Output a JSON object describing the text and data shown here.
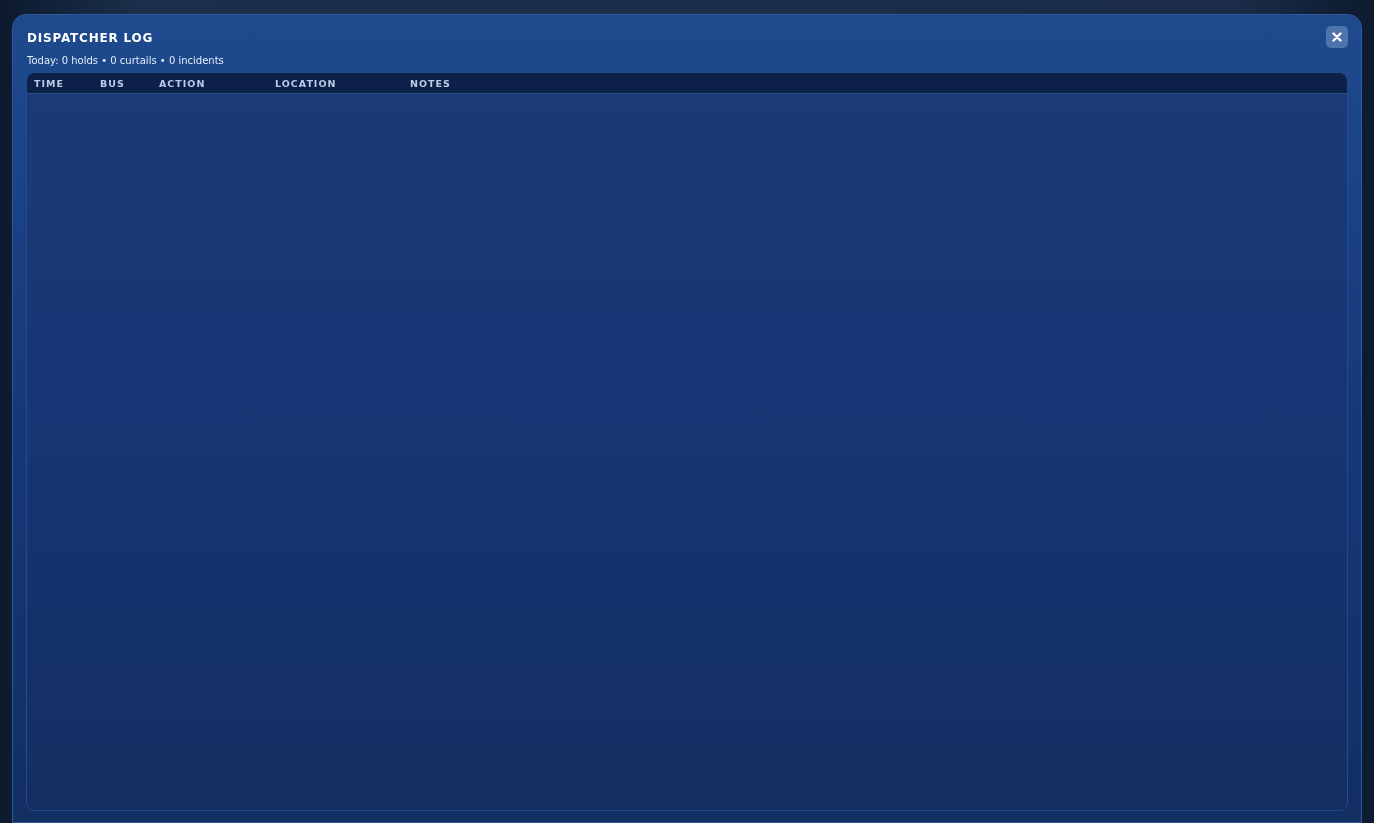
{
  "window": {
    "title": "DISPATCHER LOG",
    "summary": "Today: 0 holds • 0 curtails • 0 incidents"
  },
  "table": {
    "columns": [
      "TIME",
      "BUS",
      "ACTION",
      "LOCATION",
      "NOTES"
    ]
  }
}
